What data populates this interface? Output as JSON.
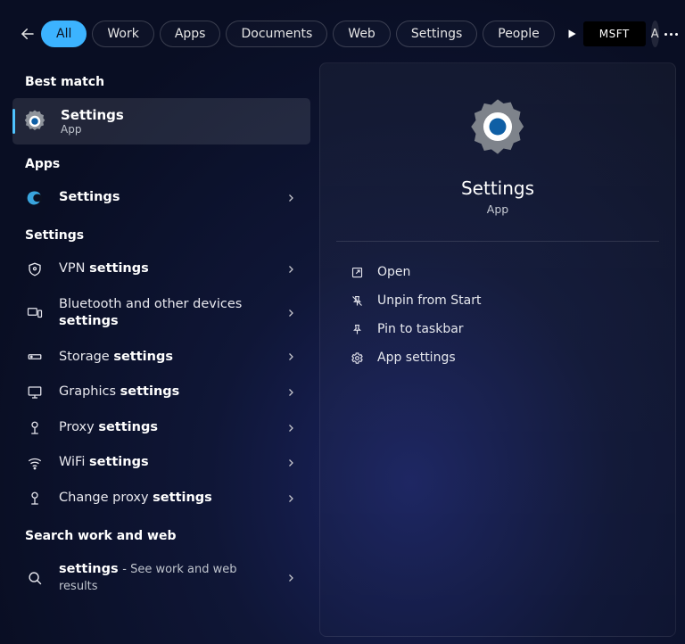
{
  "header": {
    "tabs": [
      {
        "label": "All",
        "active": true
      },
      {
        "label": "Work",
        "active": false
      },
      {
        "label": "Apps",
        "active": false
      },
      {
        "label": "Documents",
        "active": false
      },
      {
        "label": "Web",
        "active": false
      },
      {
        "label": "Settings",
        "active": false
      },
      {
        "label": "People",
        "active": false
      }
    ],
    "msft_label": "MSFT",
    "avatar_initial": "A"
  },
  "left": {
    "best_match": {
      "heading": "Best match",
      "title": "Settings",
      "subtitle": "App"
    },
    "apps": {
      "heading": "Apps",
      "items": [
        {
          "icon": "edge-icon",
          "label_html": "<b>Settings</b>"
        }
      ]
    },
    "settings": {
      "heading": "Settings",
      "items": [
        {
          "icon": "shield-icon",
          "label_html": "VPN <b>settings</b>"
        },
        {
          "icon": "devices-icon",
          "label_html": "Bluetooth and other devices <b>settings</b>"
        },
        {
          "icon": "storage-icon",
          "label_html": "Storage <b>settings</b>"
        },
        {
          "icon": "monitor-icon",
          "label_html": "Graphics <b>settings</b>"
        },
        {
          "icon": "proxy-icon",
          "label_html": "Proxy <b>settings</b>"
        },
        {
          "icon": "wifi-icon",
          "label_html": "WiFi <b>settings</b>"
        },
        {
          "icon": "proxy-icon",
          "label_html": "Change proxy <b>settings</b>"
        }
      ]
    },
    "web": {
      "heading": "Search work and web",
      "items": [
        {
          "icon": "search-icon",
          "label_html": "<b>settings</b> <span class='sub'>- See work and web results</span>"
        }
      ]
    }
  },
  "preview": {
    "title": "Settings",
    "subtitle": "App",
    "actions": [
      {
        "icon": "open-icon",
        "label": "Open"
      },
      {
        "icon": "unpin-icon",
        "label": "Unpin from Start"
      },
      {
        "icon": "pin-icon",
        "label": "Pin to taskbar"
      },
      {
        "icon": "gear-icon",
        "label": "App settings"
      }
    ]
  }
}
